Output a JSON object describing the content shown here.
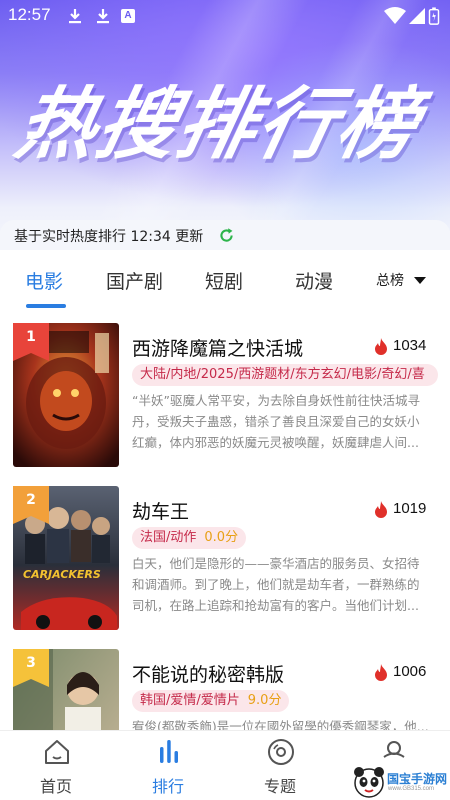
{
  "status": {
    "time": "12:57",
    "sim": "A"
  },
  "header": {
    "title": "热搜排行榜",
    "update_text": "基于实时热度排行 12:34 更新"
  },
  "tabs": [
    {
      "label": "电影",
      "active": true
    },
    {
      "label": "国产剧",
      "active": false
    },
    {
      "label": "短剧",
      "active": false
    },
    {
      "label": "动漫",
      "active": false
    }
  ],
  "sort": {
    "label": "总榜"
  },
  "items": [
    {
      "rank": "1",
      "title": "西游降魔篇之快活城",
      "heat": "1034",
      "tags": "大陆/内地/2025/西游题材/东方玄幻/电影/奇幻/喜",
      "score": "",
      "desc": "“半妖”驱魔人常平安，为去除自身妖性前往快活城寻丹，受叛夫子蛊惑，错杀了善良且深爱自己的女妖小红癫，体内邪恶的妖魔元灵被唤醒，妖魔肆虐人间..."
    },
    {
      "rank": "2",
      "title": "劫车王",
      "heat": "1019",
      "tags": "法国/动作",
      "score": "0.0分",
      "desc": "白天，他们是隐形的——豪华酒店的服务员、女招待和调酒师。到了晚上，他们就是劫车者，一群熟练的司机，在路上追踪和抢劫富有的客户。当他们计划..."
    },
    {
      "rank": "3",
      "title": "不能说的秘密韩版",
      "heat": "1006",
      "tags": "韩国/爱情/爱情片",
      "score": "9.0分",
      "desc": "宥俊(都敬秀飾)是一位在國外留學的優秀鋼琴家，他..."
    }
  ],
  "nav": [
    {
      "label": "首页",
      "active": false
    },
    {
      "label": "排行",
      "active": true
    },
    {
      "label": "专题",
      "active": false
    },
    {
      "label": "",
      "active": false
    }
  ],
  "watermark": {
    "title": "国宝手游网",
    "site": "www.GB315.com"
  },
  "colors": {
    "accent": "#2a7de1",
    "tag_bg": "#fbe6ea",
    "tag_text": "#c52a4a",
    "score": "#e8a016",
    "rank1": "#e8443a",
    "rank2": "#f2a03a",
    "rank3": "#f5c23a"
  }
}
